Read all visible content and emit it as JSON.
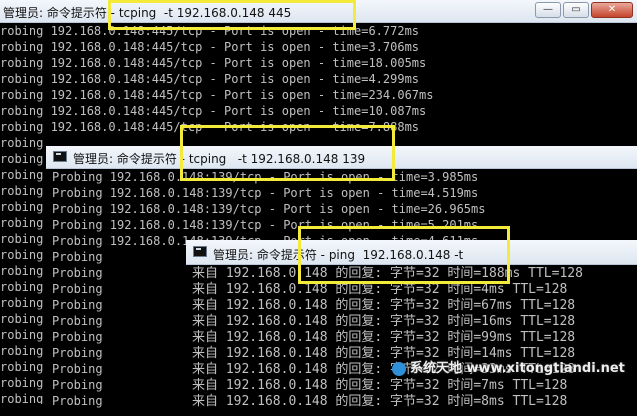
{
  "win1": {
    "title": "管理员: 命令提示符 - tcping  -t 192.168.0.148 445",
    "buttons": {
      "minimize": "—",
      "restore": "▭",
      "close": "✕"
    },
    "lines": [
      "robing 192.168.0.148:445/tcp - Port is open - time=6.772ms",
      "robing 192.168.0.148:445/tcp - Port is open - time=3.706ms",
      "robing 192.168.0.148:445/tcp - Port is open - time=18.005ms",
      "robing 192.168.0.148:445/tcp - Port is open - time=4.299ms",
      "robing 192.168.0.148:445/tcp - Port is open - time=234.067ms",
      "robing 192.168.0.148:445/tcp - Port is open - time=10.087ms",
      "robing 192.168.0.148:445/tcp - Port is open - time=7.888ms",
      "robing",
      "robing",
      "robing",
      "robing",
      "robing",
      "robing",
      "robing",
      "robing",
      "robing",
      "robing",
      "robing",
      "robing",
      "robing",
      "robing",
      "robing",
      "robing",
      "robing",
      "robing"
    ]
  },
  "win2": {
    "title": "管理员: 命令提示符 - tcping   -t 192.168.0.148 139",
    "lines": [
      "Probing 192.168.0.148:139/tcp - Port is open - time=3.985ms",
      "Probing 192.168.0.148:139/tcp - Port is open - time=4.519ms",
      "Probing 192.168.0.148:139/tcp - Port is open - time=26.965ms",
      "Probing 192.168.0.148:139/tcp - Port is open - time=5.201ms",
      "Probing 192.168.0.148:139/tcp - Port is open - time=4.611ms",
      "Probing",
      "Probing",
      "Probing",
      "Probing",
      "Probing",
      "Probing",
      "Probing",
      "Probing",
      "Probing",
      "Probing"
    ]
  },
  "win3": {
    "title": "管理员: 命令提示符 - ping  192.168.0.148 -t",
    "lines": [
      "来自 192.168.0.148 的回复: 字节=32 时间=188ms TTL=128",
      "来自 192.168.0.148 的回复: 字节=32 时间=4ms TTL=128",
      "来自 192.168.0.148 的回复: 字节=32 时间=67ms TTL=128",
      "来自 192.168.0.148 的回复: 字节=32 时间=16ms TTL=128",
      "来自 192.168.0.148 的回复: 字节=32 时间=99ms TTL=128",
      "来自 192.168.0.148 的回复: 字节=32 时间=14ms TTL=128",
      "来自 192.168.0.148 的回复: 字节=32 时间=33ms TTL=128",
      "来自 192.168.0.148 的回复: 字节=32 时间=7ms TTL=128",
      "来自 192.168.0.148 的回复: 字节=32 时间=8ms TTL=128"
    ]
  },
  "watermark": "系统天地 www.xitongtiandi.net",
  "colors": {
    "highlight": "#f3ea3a",
    "terminal_bg": "#000000",
    "terminal_fg": "#c0c0c0"
  }
}
